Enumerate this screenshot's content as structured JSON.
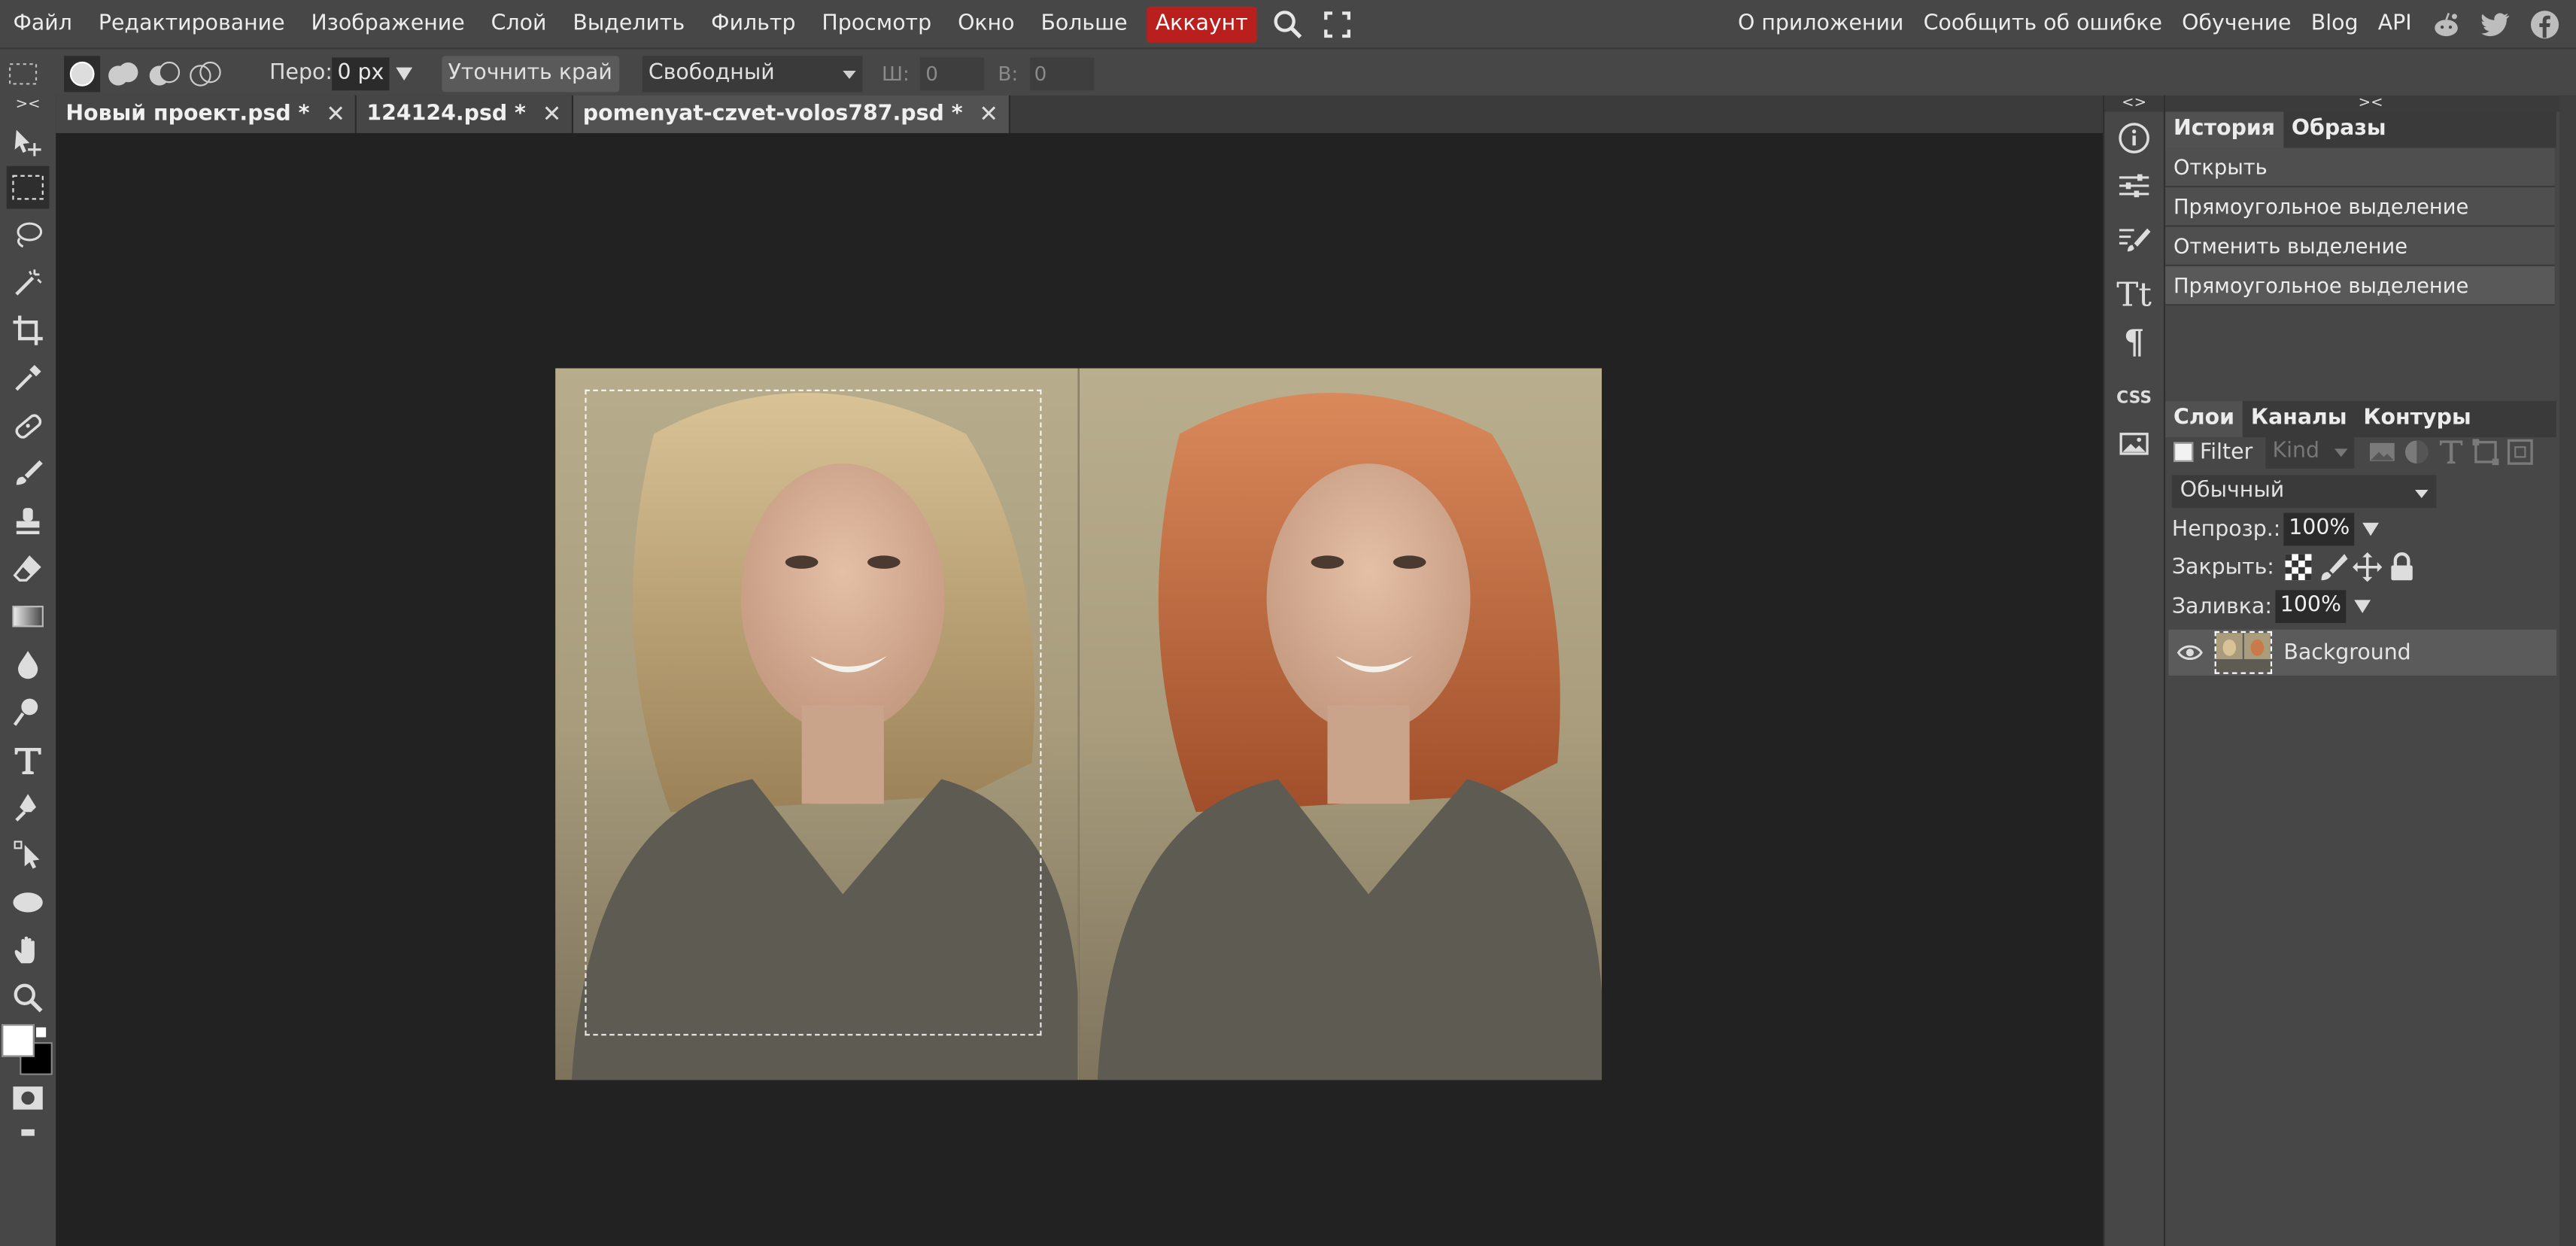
{
  "menu": {
    "items": [
      "Файл",
      "Редактирование",
      "Изображение",
      "Слой",
      "Выделить",
      "Фильтр",
      "Просмотр",
      "Окно",
      "Больше"
    ],
    "account": "Аккаунт",
    "right_items": [
      "О приложении",
      "Сообщить об ошибке",
      "Обучение",
      "Blog",
      "API"
    ],
    "icons": [
      "search-icon",
      "fullscreen-icon"
    ],
    "social": [
      "reddit-icon",
      "twitter-icon",
      "facebook-icon"
    ]
  },
  "options": {
    "feather_label": "Перо:",
    "feather_value": "0 px",
    "refine_edge": "Уточнить край",
    "style_value": "Свободный",
    "width_label": "Ш:",
    "width_value": "0",
    "height_label": "В:",
    "height_value": "0"
  },
  "tabs": [
    {
      "label": "Новый проект.psd *",
      "close": "✕"
    },
    {
      "label": "124124.psd *",
      "close": "✕"
    },
    {
      "label": "pomenyat-czvet-volos787.psd *",
      "close": "✕"
    }
  ],
  "toolbar": {
    "collapse": "><",
    "tools": [
      "move-tool-icon",
      "rect-select-tool-icon",
      "lasso-tool-icon",
      "magic-wand-tool-icon",
      "crop-tool-icon",
      "eyedropper-tool-icon",
      "healing-tool-icon",
      "brush-tool-icon",
      "clone-stamp-tool-icon",
      "eraser-tool-icon",
      "gradient-tool-icon",
      "blur-tool-icon",
      "dodge-tool-icon",
      "type-tool-icon",
      "pen-tool-icon",
      "path-select-tool-icon",
      "shape-tool-icon",
      "hand-tool-icon",
      "zoom-tool-icon"
    ]
  },
  "iconcol": {
    "collapse": "<>",
    "icons": [
      "info-icon",
      "adjustments-icon",
      "brush-settings-icon",
      "character-icon",
      "paragraph-icon",
      "css-icon",
      "image-icon"
    ],
    "css_label": "CSS",
    "type_label": "Tt",
    "para_label": "¶"
  },
  "panels": {
    "collapse": "><",
    "history_tabs": [
      "История",
      "Образы"
    ],
    "history_items": [
      "Открыть",
      "Прямоугольное выделение",
      "Отменить выделение",
      "Прямоугольное выделение"
    ],
    "layer_tabs": [
      "Слои",
      "Каналы",
      "Контуры"
    ],
    "filter_label": "Filter",
    "kind_placeholder": "Kind",
    "blend_mode": "Обычный",
    "opacity_label": "Непрозр.:",
    "opacity_value": "100%",
    "lock_label": "Закрыть:",
    "fill_label": "Заливка:",
    "fill_value": "100%",
    "layer_name": "Background"
  },
  "colors": {
    "account_bg": "#b9201d",
    "panel_bg": "#474747",
    "workspace_bg": "#222222",
    "foreground": "#ffffff",
    "background": "#000000"
  }
}
